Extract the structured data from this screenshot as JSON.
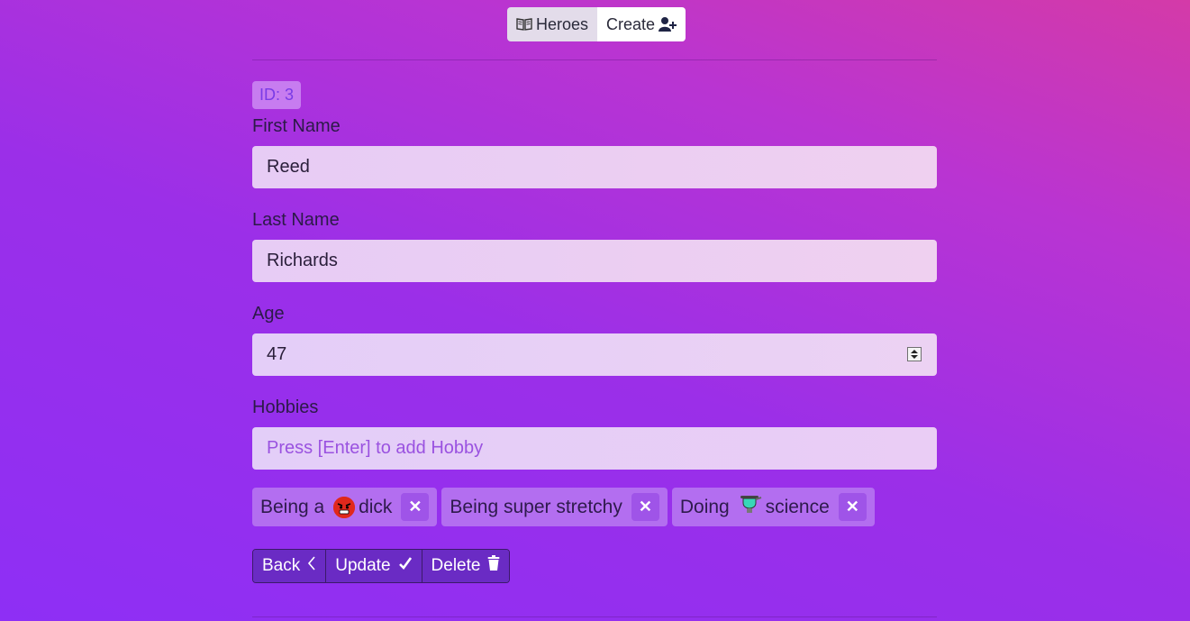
{
  "nav": {
    "heroes_label": "Heroes",
    "create_label": "Create"
  },
  "hero": {
    "id_label": "ID: 3"
  },
  "form": {
    "first_name_label": "First Name",
    "first_name_value": "Reed",
    "last_name_label": "Last Name",
    "last_name_value": "Richards",
    "age_label": "Age",
    "age_value": "47",
    "hobbies_label": "Hobbies",
    "hobby_placeholder": "Press [Enter] to add Hobby"
  },
  "hobbies": [
    {
      "prefix": "Being a ",
      "icon": "angry-face-icon",
      "suffix": "dick"
    },
    {
      "prefix": "Being super stretchy",
      "icon": "",
      "suffix": ""
    },
    {
      "prefix": "Doing ",
      "icon": "flask-icon",
      "suffix": "science"
    }
  ],
  "actions": {
    "back_label": "Back",
    "update_label": "Update",
    "delete_label": "Delete"
  },
  "colors": {
    "accent": "#6a2bc4",
    "tag": "#b36ef0"
  }
}
